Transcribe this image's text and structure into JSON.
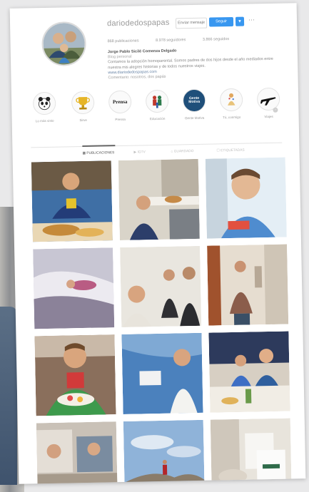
{
  "profile": {
    "username": "dariodedospapas",
    "message_label": "Enviar mensaje",
    "follow_label": "Seguir",
    "arrow_label": "▾",
    "more_label": "···",
    "stats": {
      "posts": "868 publicaciones",
      "followers": "8.978 seguidores",
      "following": "3.866 seguidos"
    },
    "bio": {
      "name": "Jorge Pablo Sicilé Comenza Delgado",
      "category": "Blog personal",
      "text": "Contamos la adopción homoparental. Somos padres de dos hijos desde el año mediados entre nuestra mis alegres historias y de todos nuestros viajes.",
      "link": "www.diariodedospapas.com",
      "followed_by": "Comentario: nosotros, dos papás"
    }
  },
  "highlights": [
    {
      "label": "Lo más visto",
      "icon": "panda-icon"
    },
    {
      "label": "Sirve",
      "icon": "trophy-icon"
    },
    {
      "label": "Prensa",
      "icon": "press-icon",
      "text": "Prensa"
    },
    {
      "label": "Educación",
      "icon": "family-icon"
    },
    {
      "label": "Gente Motiva",
      "icon": "badge-icon",
      "text": "Gente Motiva"
    },
    {
      "label": "Tú, conmigo",
      "icon": "kids-icon"
    },
    {
      "label": "Viajes",
      "icon": "airplane-icon"
    }
  ],
  "tabs": [
    {
      "label": "▦ PUBLICACIONES"
    },
    {
      "label": "▶ IGTV"
    },
    {
      "label": "⌂ GUARDADO"
    },
    {
      "label": "☐ ETIQUETADAS"
    }
  ],
  "colors": {
    "follow_blue": "#3897f0",
    "border": "#dbdbdb"
  }
}
